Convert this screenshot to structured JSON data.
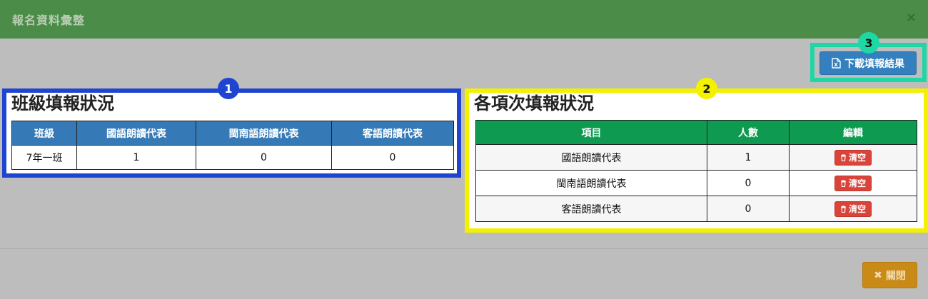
{
  "dialog": {
    "title": "報名資料彙整",
    "close_glyph": "×"
  },
  "annotations": {
    "badge1": "1",
    "badge2": "2",
    "badge3": "3"
  },
  "toolbar": {
    "download_label": "下載填報結果",
    "download_icon": "excel-file-icon"
  },
  "class_status": {
    "title": "班級填報狀況",
    "headers": [
      "班級",
      "國語朗讀代表",
      "閩南語朗讀代表",
      "客語朗讀代表"
    ],
    "rows": [
      {
        "class": "7年一班",
        "mandarin": "1",
        "minnan": "0",
        "hakka": "0"
      }
    ]
  },
  "item_status": {
    "title": "各項次填報狀況",
    "headers": [
      "項目",
      "人數",
      "編輯"
    ],
    "rows": [
      {
        "item": "國語朗讀代表",
        "count": "1",
        "action": "清空"
      },
      {
        "item": "閩南語朗讀代表",
        "count": "0",
        "action": "清空"
      },
      {
        "item": "客語朗讀代表",
        "count": "0",
        "action": "清空"
      }
    ]
  },
  "footer": {
    "close_label": "關閉",
    "close_icon": "✖"
  },
  "colors": {
    "header_green": "#4a8c48",
    "table_blue": "#357ab7",
    "table_green": "#0f9a52",
    "danger": "#d9443a",
    "warning": "#c98a17",
    "highlight_blue": "#1f45d0",
    "highlight_yellow": "#f4f100",
    "highlight_teal": "#1fd7a4"
  }
}
